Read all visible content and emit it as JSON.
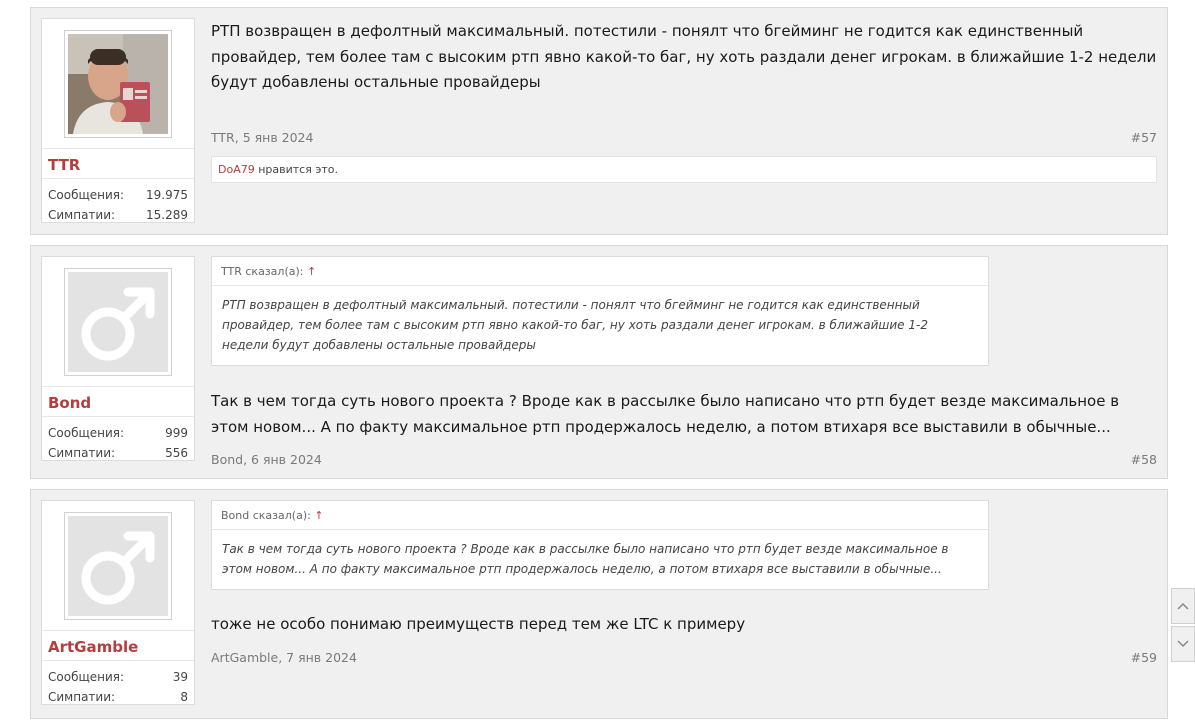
{
  "posts": [
    {
      "username": "TTR",
      "stats": {
        "messages_label": "Сообщения:",
        "messages": "19.975",
        "likes_label": "Симпатии:",
        "likes": "15.289"
      },
      "message": "РТП возвращен в дефолтный максимальный. потестили - понялт что бгейминг не годится как единственный провайдер, тем более там с высоким ртп явно какой-то баг, ну хоть раздали денег игрокам. в ближайшие 1-2 недели будут добавлены остальные провайдеры",
      "meta": {
        "author": "TTR",
        "date": ", 5 янв 2024",
        "permalink": "#57"
      },
      "like_bar": {
        "liker": "DoA79",
        "text": " нравится это."
      }
    },
    {
      "username": "Bond",
      "stats": {
        "messages_label": "Сообщения:",
        "messages": "999",
        "likes_label": "Симпатии:",
        "likes": "556"
      },
      "quote": {
        "author_line": "TTR сказал(а):",
        "arrow": "↑",
        "text": "РТП возвращен в дефолтный максимальный. потестили - понялт что бгейминг не годится как единственный провайдер, тем более там с высоким ртп явно какой-то баг, ну хоть раздали денег игрокам. в ближайшие 1-2 недели будут добавлены остальные провайдеры"
      },
      "message": "Так в чем тогда суть нового проекта ? Вроде как в рассылке было написано что ртп будет везде максимальное в этом новом... А по факту максимальное ртп продержалось неделю, а потом втихаря все выставили в обычные...",
      "meta": {
        "author": "Bond",
        "date": ", 6 янв 2024",
        "permalink": "#58"
      }
    },
    {
      "username": "ArtGamble",
      "stats": {
        "messages_label": "Сообщения:",
        "messages": "39",
        "likes_label": "Симпатии:",
        "likes": "8"
      },
      "quote": {
        "author_line": "Bond сказал(а):",
        "arrow": "↑",
        "text": "Так в чем тогда суть нового проекта ? Вроде как в рассылке было написано что ртп будет везде максимальное в этом новом... А по факту максимальное ртп продержалось неделю, а потом втихаря все выставили в обычные..."
      },
      "message": "тоже не особо понимаю преимуществ перед тем же LTC к примеру",
      "meta": {
        "author": "ArtGamble",
        "date": ", 7 янв 2024",
        "permalink": "#59"
      }
    }
  ],
  "colors": {
    "username": "#b53d3d",
    "post_bg": "#f0f0f0",
    "border": "#d8d8d8"
  },
  "icons": {
    "default_avatar": "male-symbol-icon",
    "scroll_up": "chevron-up-icon",
    "scroll_down": "chevron-down-icon"
  }
}
